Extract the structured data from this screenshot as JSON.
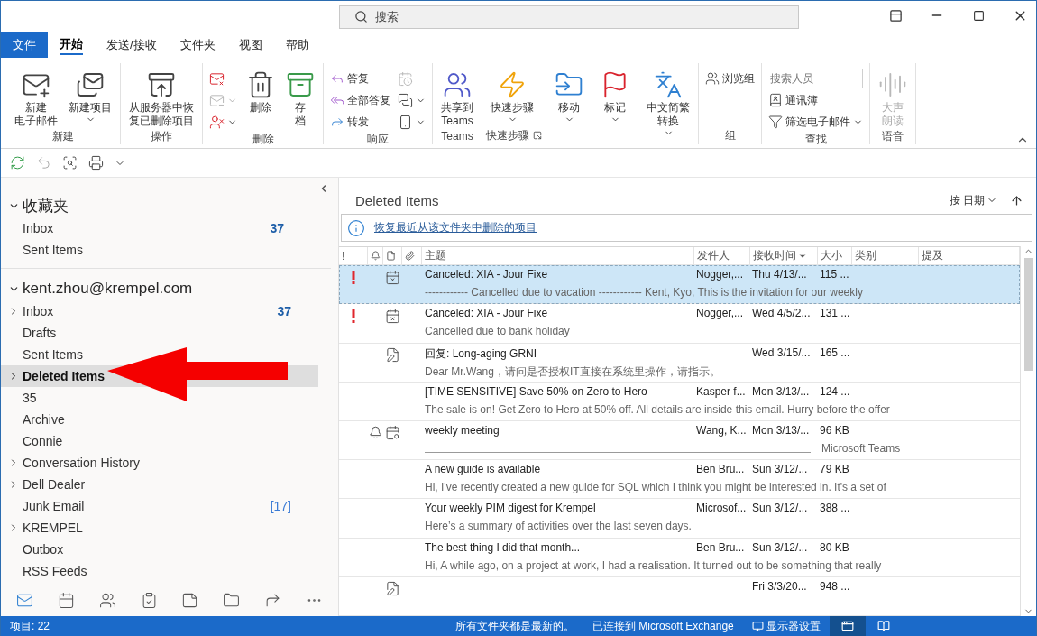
{
  "title_bar": {
    "search_placeholder": "搜索"
  },
  "tabs": [
    {
      "label": "文件",
      "kind": "file",
      "selected": false
    },
    {
      "label": "开始",
      "kind": "tab",
      "selected": true
    },
    {
      "label": "发送/接收",
      "kind": "tab",
      "selected": false
    },
    {
      "label": "文件夹",
      "kind": "tab",
      "selected": false
    },
    {
      "label": "视图",
      "kind": "tab",
      "selected": false
    },
    {
      "label": "帮助",
      "kind": "tab",
      "selected": false
    }
  ],
  "ribbon": {
    "groups": [
      {
        "label": "新建",
        "items": [
          {
            "kind": "large",
            "label_lines": [
              "新建",
              "电子邮件"
            ]
          },
          {
            "kind": "large",
            "label_lines": [
              "新建项目"
            ],
            "dropdown": true
          }
        ]
      },
      {
        "label": "操作",
        "items": [
          {
            "kind": "large",
            "label_lines": [
              "从服务器中恢",
              "复已删除项目"
            ]
          }
        ]
      },
      {
        "label": "删除",
        "items": [
          {
            "kind": "icon"
          },
          {
            "kind": "icon",
            "dropdown": true,
            "disabled": true
          },
          {
            "kind": "icon",
            "dropdown": true
          },
          {
            "kind": "large",
            "label_lines": [
              "删除"
            ]
          },
          {
            "kind": "large",
            "label_lines": [
              "存",
              "档"
            ]
          }
        ]
      },
      {
        "label": "响应",
        "items": [
          {
            "kind": "small",
            "label": "答复"
          },
          {
            "kind": "small",
            "label": "全部答复"
          },
          {
            "kind": "small",
            "label": "转发"
          },
          {
            "kind": "icon",
            "disabled": true
          },
          {
            "kind": "icon",
            "dropdown": true
          },
          {
            "kind": "icon",
            "dropdown": true
          }
        ]
      },
      {
        "label": "Teams",
        "items": [
          {
            "kind": "large",
            "label_lines": [
              "共享到",
              "Teams"
            ]
          }
        ]
      },
      {
        "label": "快速步骤",
        "launcher": true,
        "items": [
          {
            "kind": "large",
            "label_lines": [
              "快速步骤"
            ],
            "dropdown": true
          }
        ]
      },
      {
        "items": [
          {
            "kind": "large",
            "label_lines": [
              "移动"
            ],
            "dropdown": true
          }
        ]
      },
      {
        "items": [
          {
            "kind": "large",
            "label_lines": [
              "标记"
            ],
            "dropdown": true
          }
        ]
      },
      {
        "items": [
          {
            "kind": "large",
            "label_lines": [
              "中文简繁",
              "转换"
            ],
            "dropdown": true
          }
        ]
      },
      {
        "label": "组",
        "items": [
          {
            "kind": "small",
            "label": "浏览组"
          }
        ]
      },
      {
        "label": "查找",
        "items": [
          {
            "kind": "field",
            "placeholder": "搜索人员"
          },
          {
            "kind": "small",
            "label": "通讯簿"
          },
          {
            "kind": "small",
            "label": "筛选电子邮件",
            "dropdown": true
          }
        ]
      },
      {
        "label": "语音",
        "items": [
          {
            "kind": "large",
            "label_lines": [
              "大声",
              "朗读"
            ],
            "disabled": true
          }
        ]
      }
    ]
  },
  "quick_access": [
    {
      "disabled": false
    },
    {
      "disabled": true
    },
    {
      "disabled": false
    },
    {
      "disabled": false
    }
  ],
  "folder_pane": {
    "sections": [
      {
        "title": "收藏夹",
        "expanded": true,
        "folders": [
          {
            "label": "Inbox",
            "count": "37",
            "unread": true,
            "has_children": false,
            "selected": false
          },
          {
            "label": "Sent Items",
            "has_children": false,
            "selected": false
          }
        ]
      },
      {
        "title": "kent.zhou@krempel.com",
        "expanded": true,
        "folders": [
          {
            "label": "Inbox",
            "count": "37",
            "unread": true,
            "has_children": true,
            "selected": false
          },
          {
            "label": "Drafts",
            "has_children": false,
            "selected": false
          },
          {
            "label": "Sent Items",
            "has_children": false,
            "selected": false
          },
          {
            "label": "Deleted Items",
            "has_children": true,
            "selected": true
          },
          {
            "label": "35",
            "has_children": false,
            "selected": false
          },
          {
            "label": "Archive",
            "has_children": false,
            "selected": false
          },
          {
            "label": "Connie",
            "has_children": false,
            "selected": false
          },
          {
            "label": "Conversation History",
            "has_children": true,
            "selected": false
          },
          {
            "label": "Dell Dealer",
            "has_children": true,
            "selected": false
          },
          {
            "label": "Junk Email",
            "count": "[17]",
            "unread": false,
            "has_children": false,
            "selected": false
          },
          {
            "label": "KREMPEL",
            "has_children": true,
            "selected": false
          },
          {
            "label": "Outbox",
            "has_children": false,
            "selected": false
          },
          {
            "label": "RSS Feeds",
            "has_children": false,
            "selected": false
          }
        ]
      }
    ],
    "nav": [
      {
        "selected": true
      },
      {
        "selected": false
      },
      {
        "selected": false
      },
      {
        "selected": false
      },
      {
        "selected": false
      },
      {
        "selected": false
      },
      {
        "selected": false
      },
      {
        "selected": false
      }
    ]
  },
  "message_list": {
    "title": "Deleted Items",
    "sort_label": "按 日期",
    "info_link": "恢复最近从该文件夹中删除的项目",
    "columns": [
      {
        "label": "!",
        "sorted": false
      },
      {
        "label": "主题",
        "sorted": false
      },
      {
        "label": "发件人",
        "sorted": false
      },
      {
        "label": "接收时间",
        "sorted": true
      },
      {
        "label": "大小",
        "sorted": false
      },
      {
        "label": "类别",
        "sorted": false
      },
      {
        "label": "提及",
        "sorted": false
      }
    ],
    "rows": [
      {
        "kind": "canceled",
        "important": true,
        "reminder": false,
        "selected": true,
        "subject": "Canceled: XIA - Jour Fixe",
        "sender": "Nogger,...",
        "received": "Thu 4/13/...",
        "size": "115 ...",
        "preview": "------------ Cancelled due to vacation ------------  Kent, Kyo,  This is the invitation for our weekly"
      },
      {
        "kind": "canceled",
        "important": true,
        "reminder": false,
        "selected": false,
        "subject": "Canceled: XIA - Jour Fixe",
        "sender": "Nogger,...",
        "received": "Wed 4/5/2...",
        "size": "131 ...",
        "preview": "Cancelled due to bank holiday"
      },
      {
        "kind": "draft",
        "important": false,
        "reminder": false,
        "selected": false,
        "subject": "回复: Long-aging GRNI",
        "received": "Wed 3/15/...",
        "size": "165 ...",
        "preview": "Dear Mr.Wang，请问是否授权IT直接在系统里操作，请指示。"
      },
      {
        "kind": "mail",
        "important": false,
        "reminder": false,
        "selected": false,
        "subject": "[TIME SENSITIVE] Save 50% on Zero to Hero",
        "sender": "Kasper f...",
        "received": "Mon 3/13/...",
        "size": "124 ...",
        "preview": "The sale is on! Get Zero to Hero at 50% off. All details are inside this email. Hurry before the offer"
      },
      {
        "kind": "meeting",
        "important": false,
        "reminder": true,
        "selected": false,
        "subject": "weekly meeting",
        "sender": "Wang, K...",
        "received": "Mon 3/13/...",
        "size": "96 KB",
        "preview": "Microsoft Teams"
      },
      {
        "kind": "mail",
        "important": false,
        "reminder": false,
        "selected": false,
        "subject": "A new guide is available",
        "sender": "Ben Bru...",
        "received": "Sun 3/12/...",
        "size": "79 KB",
        "preview": "Hi,  I've recently created a new guide for SQL which I think you might be interested in.  It's a set of"
      },
      {
        "kind": "mail",
        "important": false,
        "reminder": false,
        "selected": false,
        "subject": "Your weekly PIM digest for Krempel",
        "sender": "Microsof...",
        "received": "Sun 3/12/...",
        "size": "388 ...",
        "preview": "Here’s a summary of activities over the last seven days."
      },
      {
        "kind": "mail",
        "important": false,
        "reminder": false,
        "selected": false,
        "subject": "The best thing I did that month...",
        "sender": "Ben Bru...",
        "received": "Sun 3/12/...",
        "size": "80 KB",
        "preview": "Hi,  A while ago, on a project at work, I had a realisation.  It turned out to be something that really"
      },
      {
        "kind": "draft",
        "important": false,
        "reminder": false,
        "selected": false,
        "received": "Fri 3/3/20...",
        "size": "948 ..."
      }
    ]
  },
  "status_bar": {
    "items_count": "项目: 22",
    "sync": "所有文件夹都是最新的。",
    "connection": "已连接到 Microsoft Exchange",
    "display_settings": "显示器设置",
    "views": [
      {
        "selected": true
      },
      {
        "selected": false
      }
    ]
  }
}
